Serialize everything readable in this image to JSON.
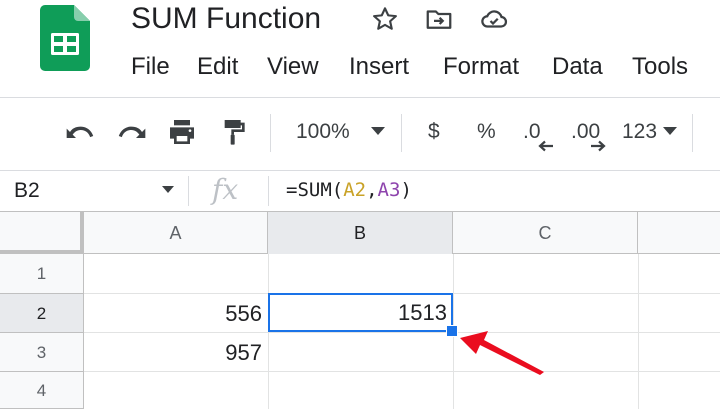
{
  "app": {
    "title": "SUM Function",
    "icons": [
      "sheets-logo",
      "star-icon",
      "move-to-folder-icon",
      "cloud-saved-icon"
    ],
    "brand_color": "#0f9d58"
  },
  "menu": [
    "File",
    "Edit",
    "View",
    "Insert",
    "Format",
    "Data",
    "Tools"
  ],
  "toolbar": {
    "zoom": "100%",
    "currency": "$",
    "percent": "%",
    "decrease_decimal": ".0",
    "increase_decimal": ".00",
    "more_formats": "123",
    "icons": [
      "undo-icon",
      "redo-icon",
      "print-icon",
      "paint-format-icon",
      "chevron-down-icon"
    ]
  },
  "formula_bar": {
    "name_box": "B2",
    "fx": "fx",
    "formula": {
      "prefix": "=SUM(",
      "ref1": "A2",
      "comma": ",",
      "ref2": "A3",
      "suffix": ")"
    },
    "ref_colors": {
      "ref1": "#c9a227",
      "ref2": "#8e44ad"
    }
  },
  "grid": {
    "columns": [
      "A",
      "B",
      "C"
    ],
    "rows": [
      "1",
      "2",
      "3",
      "4"
    ],
    "cells": {
      "A2": "556",
      "B2": "1513",
      "A3": "957"
    },
    "selected_cell": "B2",
    "selection_color": "#1a73e8",
    "annotation_arrow_color": "#ea0d1f"
  }
}
